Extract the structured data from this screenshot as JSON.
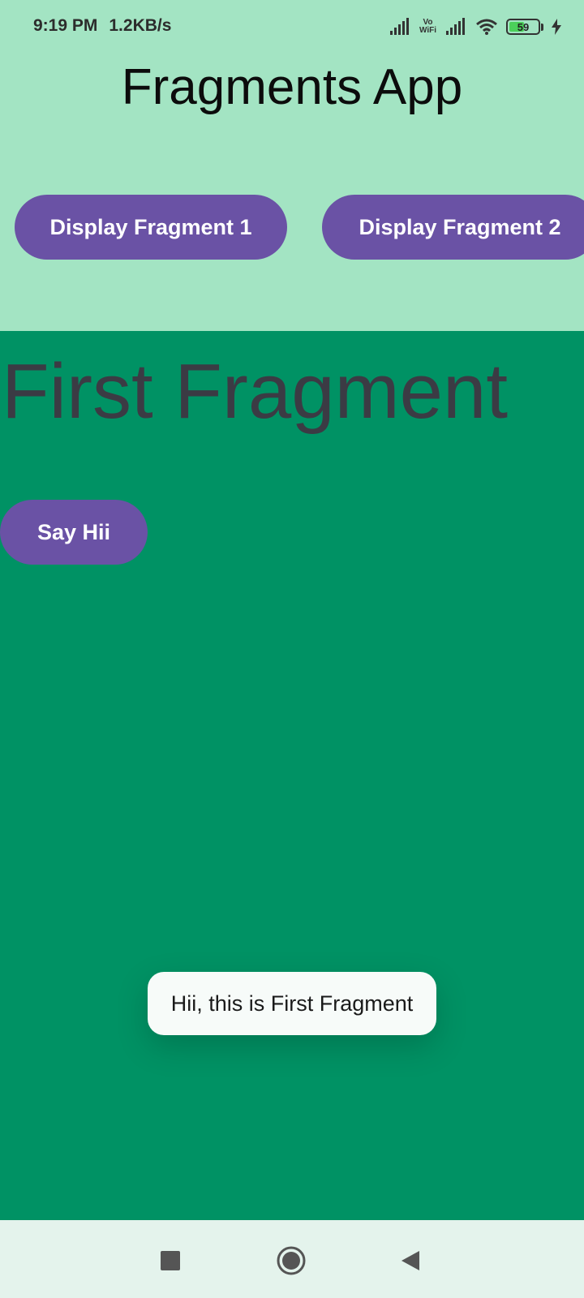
{
  "status_bar": {
    "time": "9:19 PM",
    "speed": "1.2KB/s",
    "vowifi_top": "Vo",
    "vowifi_bottom": "WiFi",
    "battery_percent": 59,
    "battery_label": "59",
    "charging": true
  },
  "app": {
    "title": "Fragments App",
    "button_fragment_1": "Display Fragment 1",
    "button_fragment_2": "Display Fragment 2"
  },
  "fragment": {
    "title": "First Fragment",
    "say_button": "Say Hii"
  },
  "toast": {
    "message": "Hii, this is First Fragment"
  },
  "colors": {
    "header_background": "#a3e4c3",
    "fragment_background": "#009264",
    "button": "#6a52a5",
    "fragment_title": "#3b3b44"
  },
  "nav_icons": [
    "recent-apps-icon",
    "home-icon",
    "back-icon"
  ]
}
